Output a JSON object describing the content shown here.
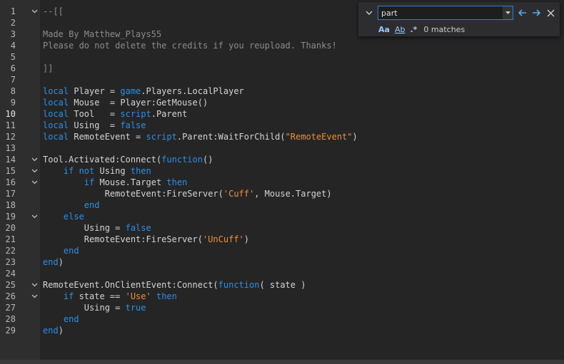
{
  "editor": {
    "active_line": 10,
    "lines": [
      {
        "n": "1",
        "fold": true,
        "code": [
          [
            "cm",
            "--[["
          ]
        ]
      },
      {
        "n": "2",
        "fold": false,
        "code": []
      },
      {
        "n": "3",
        "fold": false,
        "code": [
          [
            "cm",
            "Made By Matthew_Plays55"
          ]
        ]
      },
      {
        "n": "4",
        "fold": false,
        "code": [
          [
            "cm",
            "Please do not delete the credits if you reupload. Thanks!"
          ]
        ]
      },
      {
        "n": "5",
        "fold": false,
        "code": []
      },
      {
        "n": "6",
        "fold": false,
        "code": [
          [
            "cm",
            "]]"
          ]
        ]
      },
      {
        "n": "7",
        "fold": false,
        "code": []
      },
      {
        "n": "8",
        "fold": false,
        "code": [
          [
            "kw",
            "local"
          ],
          [
            "tx",
            " Player = "
          ],
          [
            "bu",
            "game"
          ],
          [
            "tx",
            ".Players.LocalPlayer"
          ]
        ]
      },
      {
        "n": "9",
        "fold": false,
        "code": [
          [
            "kw",
            "local"
          ],
          [
            "tx",
            " Mouse  = Player:GetMouse()"
          ]
        ]
      },
      {
        "n": "10",
        "fold": false,
        "code": [
          [
            "kw",
            "local"
          ],
          [
            "tx",
            " Tool   = "
          ],
          [
            "bu",
            "script"
          ],
          [
            "tx",
            ".Parent"
          ]
        ]
      },
      {
        "n": "11",
        "fold": false,
        "code": [
          [
            "kw",
            "local"
          ],
          [
            "tx",
            " Using  = "
          ],
          [
            "kw",
            "false"
          ]
        ]
      },
      {
        "n": "12",
        "fold": false,
        "code": [
          [
            "kw",
            "local"
          ],
          [
            "tx",
            " RemoteEvent = "
          ],
          [
            "bu",
            "script"
          ],
          [
            "tx",
            ".Parent:WaitForChild("
          ],
          [
            "st",
            "\"RemoteEvent\""
          ],
          [
            "tx",
            ")"
          ]
        ]
      },
      {
        "n": "13",
        "fold": false,
        "code": []
      },
      {
        "n": "14",
        "fold": true,
        "code": [
          [
            "tx",
            "Tool.Activated:Connect("
          ],
          [
            "kw",
            "function"
          ],
          [
            "tx",
            "()"
          ]
        ]
      },
      {
        "n": "15",
        "fold": true,
        "code": [
          [
            "tx",
            "    "
          ],
          [
            "kw",
            "if not"
          ],
          [
            "tx",
            " Using "
          ],
          [
            "kw",
            "then"
          ]
        ]
      },
      {
        "n": "16",
        "fold": true,
        "code": [
          [
            "tx",
            "        "
          ],
          [
            "kw",
            "if"
          ],
          [
            "tx",
            " Mouse.Target "
          ],
          [
            "kw",
            "then"
          ]
        ]
      },
      {
        "n": "17",
        "fold": false,
        "code": [
          [
            "tx",
            "            RemoteEvent:FireServer("
          ],
          [
            "st",
            "'Cuff'"
          ],
          [
            "tx",
            ", Mouse.Target)"
          ]
        ]
      },
      {
        "n": "18",
        "fold": false,
        "code": [
          [
            "tx",
            "        "
          ],
          [
            "kw",
            "end"
          ]
        ]
      },
      {
        "n": "19",
        "fold": true,
        "code": [
          [
            "tx",
            "    "
          ],
          [
            "kw",
            "else"
          ]
        ]
      },
      {
        "n": "20",
        "fold": false,
        "code": [
          [
            "tx",
            "        Using = "
          ],
          [
            "kw",
            "false"
          ]
        ]
      },
      {
        "n": "21",
        "fold": false,
        "code": [
          [
            "tx",
            "        RemoteEvent:FireServer("
          ],
          [
            "st",
            "'UnCuff'"
          ],
          [
            "tx",
            ")"
          ]
        ]
      },
      {
        "n": "22",
        "fold": false,
        "code": [
          [
            "tx",
            "    "
          ],
          [
            "kw",
            "end"
          ]
        ]
      },
      {
        "n": "23",
        "fold": false,
        "code": [
          [
            "kw",
            "end"
          ],
          [
            "tx",
            ")"
          ]
        ]
      },
      {
        "n": "24",
        "fold": false,
        "code": []
      },
      {
        "n": "25",
        "fold": true,
        "code": [
          [
            "tx",
            "RemoteEvent.OnClientEvent:Connect("
          ],
          [
            "kw",
            "function"
          ],
          [
            "tx",
            "( state )"
          ]
        ]
      },
      {
        "n": "26",
        "fold": true,
        "code": [
          [
            "tx",
            "    "
          ],
          [
            "kw",
            "if"
          ],
          [
            "tx",
            " state == "
          ],
          [
            "st",
            "'Use'"
          ],
          [
            "tx",
            " "
          ],
          [
            "kw",
            "then"
          ]
        ]
      },
      {
        "n": "27",
        "fold": false,
        "code": [
          [
            "tx",
            "        Using = "
          ],
          [
            "kw",
            "true"
          ]
        ]
      },
      {
        "n": "28",
        "fold": false,
        "code": [
          [
            "tx",
            "    "
          ],
          [
            "kw",
            "end"
          ]
        ]
      },
      {
        "n": "29",
        "fold": false,
        "code": [
          [
            "kw",
            "end"
          ],
          [
            "tx",
            ")"
          ]
        ]
      }
    ]
  },
  "find": {
    "query": "part",
    "options": {
      "match_case": "Aa",
      "whole_word": "Ab",
      "regex": ".*"
    },
    "match_count": "0 matches",
    "icons": {
      "toggle": "chevron-down-icon",
      "dropdown": "caret-down-icon",
      "prev": "arrow-left-icon",
      "next": "arrow-right-icon",
      "close": "close-icon"
    }
  },
  "colors": {
    "keyword": "#2c8fe6",
    "comment": "#8c8c8c",
    "string": "#ef8f3a",
    "text": "#d4d4d4",
    "find_border": "#2e7fd0"
  }
}
